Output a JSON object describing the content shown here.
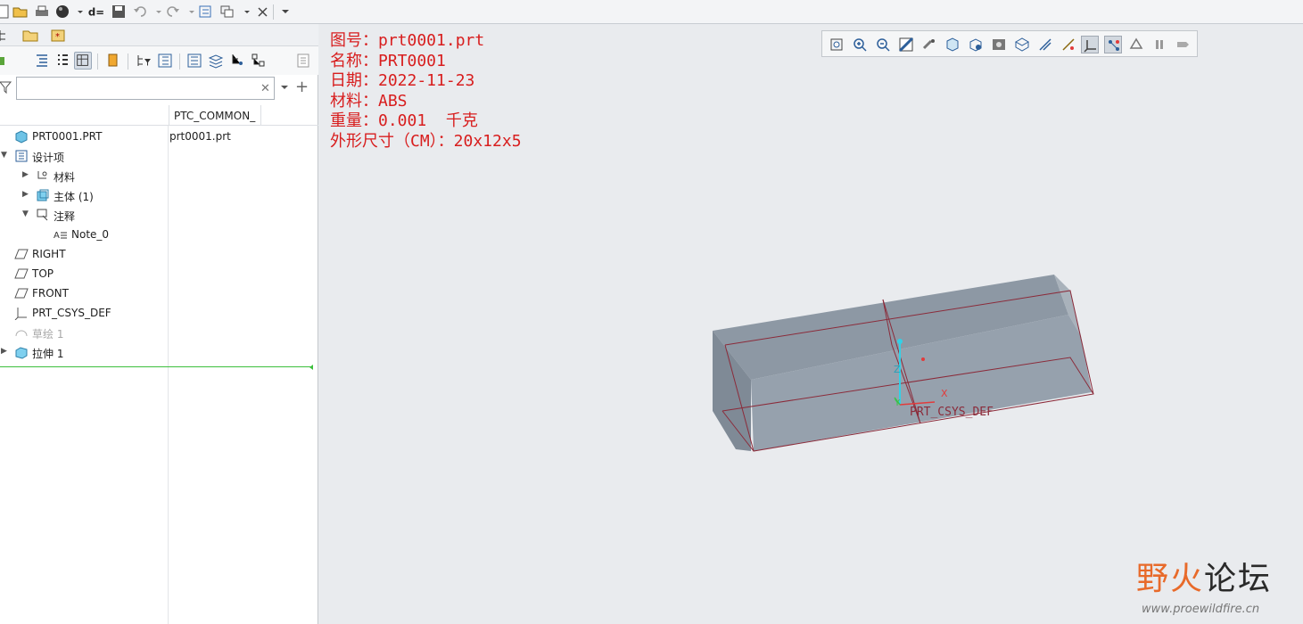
{
  "quick_access": {
    "items": [
      "new-icon",
      "open-icon",
      "print-icon",
      "sphere-icon",
      "dropdown-icon",
      "d-equals-icon",
      "save-icon",
      "undo-icon",
      "dropdown-icon",
      "redo-icon",
      "dropdown-icon",
      "regenerate-icon",
      "windows-icon",
      "dropdown-icon",
      "close-window-icon",
      "more-icon"
    ]
  },
  "left_panel": {
    "tabs": [
      "model-tree-tab",
      "folder-tab",
      "favorites-tab"
    ],
    "search": {
      "value": "",
      "placeholder": ""
    },
    "column_header": "PTC_COMMON_",
    "tree": [
      {
        "label": "PRT0001.PRT",
        "col2": "prt0001.prt",
        "icon": "part-icon",
        "indent": 0,
        "twisty": ""
      },
      {
        "label": "设计项",
        "col2": "",
        "icon": "design-items-icon",
        "indent": 0,
        "twisty": "▼"
      },
      {
        "label": "材料",
        "col2": "",
        "icon": "material-icon",
        "indent": 1,
        "twisty": "▶"
      },
      {
        "label": "主体 (1)",
        "col2": "",
        "icon": "body-icon",
        "indent": 1,
        "twisty": "▶"
      },
      {
        "label": "注释",
        "col2": "",
        "icon": "annotation-icon",
        "indent": 1,
        "twisty": "▼"
      },
      {
        "label": "Note_0",
        "col2": "",
        "icon": "note-icon",
        "indent": 2,
        "twisty": ""
      },
      {
        "label": "RIGHT",
        "col2": "",
        "icon": "datum-plane-icon",
        "indent": 0,
        "twisty": ""
      },
      {
        "label": "TOP",
        "col2": "",
        "icon": "datum-plane-icon",
        "indent": 0,
        "twisty": ""
      },
      {
        "label": "FRONT",
        "col2": "",
        "icon": "datum-plane-icon",
        "indent": 0,
        "twisty": ""
      },
      {
        "label": "PRT_CSYS_DEF",
        "col2": "",
        "icon": "csys-icon",
        "indent": 0,
        "twisty": ""
      },
      {
        "label": "草绘 1",
        "col2": "",
        "icon": "sketch-icon",
        "indent": 0,
        "twisty": "",
        "dim": true
      },
      {
        "label": "拉伸 1",
        "col2": "",
        "icon": "extrude-icon",
        "indent": 0,
        "twisty": "▶"
      }
    ]
  },
  "graphics": {
    "note_lines": [
      "图号：prt0001.prt",
      "名称：PRT0001",
      "日期：2022-11-23",
      "材料：ABS",
      "重量：0.001  千克",
      "外形尺寸（CM）：20x12x5"
    ],
    "view_toolbar": [
      "refit-icon",
      "zoom-in-icon",
      "zoom-out-icon",
      "repaint-icon",
      "spin-center-icon",
      "display-style-icon",
      "saved-orientations-icon",
      "view-manager-icon",
      "perspective-icon",
      "datum-display-icon",
      "annotation-display-icon",
      "csys-display-icon",
      "point-display-icon",
      "tags-icon",
      "pause-icon",
      "animation-icon"
    ],
    "csys_label": "PRT_CSYS_DEF",
    "axis_x": "X",
    "axis_y": "Y",
    "axis_z": "Z"
  },
  "watermark": {
    "text_a": "野火",
    "text_b": "论坛",
    "url": "www.proewildfire.cn"
  },
  "colors": {
    "note": "#d81e1e",
    "model_face": "#8f9aa6",
    "edge": "#8b2b3a",
    "insert_line": "#3cbf3c"
  }
}
